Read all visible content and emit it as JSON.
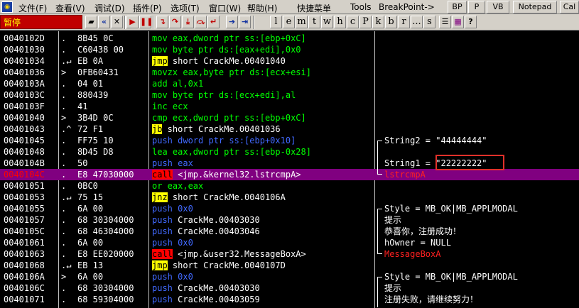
{
  "menu": {
    "items": [
      "文件(F)",
      "查看(V)",
      "调试(D)",
      "插件(P)",
      "选项(T)",
      "窗口(W)",
      "帮助(H)",
      "快捷菜单",
      "Tools",
      "BreakPoint->"
    ],
    "plugin_buttons": [
      "BP",
      "P",
      "VB",
      "Notepad",
      "Cal"
    ]
  },
  "toolbar": {
    "status": "暂停",
    "letters": [
      "l",
      "e",
      "m",
      "t",
      "w",
      "h",
      "c",
      "P",
      "k",
      "b",
      "r",
      "...",
      "s"
    ]
  },
  "rows": [
    {
      "addr": "0040102D",
      "mark": ".",
      "hex": "8B45 0C",
      "parts": [
        {
          "t": "mov",
          "s": "green"
        },
        {
          "t": " eax,dword ptr ss:[ebp+0xC]",
          "s": "green"
        }
      ]
    },
    {
      "addr": "00401030",
      "mark": ".",
      "hex": "C60438 00",
      "parts": [
        {
          "t": "mov",
          "s": "green"
        },
        {
          "t": " byte ptr ds:[eax+edi],0x0",
          "s": "green"
        }
      ]
    },
    {
      "addr": "00401034",
      "mark": ".↵",
      "hex": "EB 0A",
      "parts": [
        {
          "t": "jmp",
          "s": "jmp"
        },
        {
          "t": " short CrackMe.00401040",
          "s": ""
        }
      ]
    },
    {
      "addr": "00401036",
      "mark": ">",
      "hex": "0FB60431",
      "parts": [
        {
          "t": "movzx",
          "s": "green"
        },
        {
          "t": " eax,byte ptr ds:[ecx+esi]",
          "s": "green"
        }
      ]
    },
    {
      "addr": "0040103A",
      "mark": ".",
      "hex": "04 01",
      "parts": [
        {
          "t": "add",
          "s": "green"
        },
        {
          "t": " al,0x1",
          "s": "green"
        }
      ]
    },
    {
      "addr": "0040103C",
      "mark": ".",
      "hex": "880439",
      "parts": [
        {
          "t": "mov",
          "s": "green"
        },
        {
          "t": " byte ptr ds:[ecx+edi],al",
          "s": "green"
        }
      ]
    },
    {
      "addr": "0040103F",
      "mark": ".",
      "hex": "41",
      "parts": [
        {
          "t": "inc",
          "s": "green"
        },
        {
          "t": " ecx",
          "s": "green"
        }
      ]
    },
    {
      "addr": "00401040",
      "mark": ">",
      "hex": "3B4D 0C",
      "parts": [
        {
          "t": "cmp",
          "s": "green"
        },
        {
          "t": " ecx,dword ptr ss:[ebp+0xC]",
          "s": "green"
        }
      ]
    },
    {
      "addr": "00401043",
      "mark": ".^",
      "hex": "72 F1",
      "parts": [
        {
          "t": "jb",
          "s": "jmp"
        },
        {
          "t": " short CrackMe.00401036",
          "s": ""
        }
      ]
    },
    {
      "addr": "00401045",
      "mark": ".",
      "hex": "FF75 10",
      "parts": [
        {
          "t": "push",
          "s": "blue"
        },
        {
          "t": " dword ptr ss:[ebp+0x10]",
          "s": "blue"
        }
      ]
    },
    {
      "addr": "00401048",
      "mark": ".",
      "hex": "8D45 D8",
      "parts": [
        {
          "t": "lea",
          "s": "green"
        },
        {
          "t": " eax,dword ptr ss:[ebp-0x28]",
          "s": "green"
        }
      ]
    },
    {
      "addr": "0040104B",
      "mark": ".",
      "hex": "50",
      "parts": [
        {
          "t": "push",
          "s": "blue"
        },
        {
          "t": " eax",
          "s": "blue"
        }
      ]
    },
    {
      "addr": "0040104C",
      "mark": ".",
      "hex": "E8 47030000",
      "parts": [
        {
          "t": "call",
          "s": "call"
        },
        {
          "t": " <jmp.&kernel32.lstrcmpA>",
          "s": ""
        }
      ],
      "selected": true
    },
    {
      "addr": "00401051",
      "mark": ".",
      "hex": "0BC0",
      "parts": [
        {
          "t": "or",
          "s": "green"
        },
        {
          "t": " eax,eax",
          "s": "green"
        }
      ]
    },
    {
      "addr": "00401053",
      "mark": ".↵",
      "hex": "75 15",
      "parts": [
        {
          "t": "jnz",
          "s": "jmp"
        },
        {
          "t": " short CrackMe.0040106A",
          "s": ""
        }
      ]
    },
    {
      "addr": "00401055",
      "mark": ".",
      "hex": "6A 00",
      "parts": [
        {
          "t": "push",
          "s": "blue"
        },
        {
          "t": " 0x0",
          "s": "blue"
        }
      ]
    },
    {
      "addr": "00401057",
      "mark": ".",
      "hex": "68 30304000",
      "parts": [
        {
          "t": "push",
          "s": "blue"
        },
        {
          "t": " CrackMe.00403030",
          "s": ""
        }
      ]
    },
    {
      "addr": "0040105C",
      "mark": ".",
      "hex": "68 46304000",
      "parts": [
        {
          "t": "push",
          "s": "blue"
        },
        {
          "t": " CrackMe.00403046",
          "s": ""
        }
      ]
    },
    {
      "addr": "00401061",
      "mark": ".",
      "hex": "6A 00",
      "parts": [
        {
          "t": "push",
          "s": "blue"
        },
        {
          "t": " 0x0",
          "s": "blue"
        }
      ]
    },
    {
      "addr": "00401063",
      "mark": ".",
      "hex": "E8 EE020000",
      "parts": [
        {
          "t": "call",
          "s": "call"
        },
        {
          "t": " <jmp.&user32.MessageBoxA>",
          "s": ""
        }
      ]
    },
    {
      "addr": "00401068",
      "mark": ".↵",
      "hex": "EB 13",
      "parts": [
        {
          "t": "jmp",
          "s": "jmp"
        },
        {
          "t": " short CrackMe.0040107D",
          "s": ""
        }
      ]
    },
    {
      "addr": "0040106A",
      "mark": ">",
      "hex": "6A 00",
      "parts": [
        {
          "t": "push",
          "s": "blue"
        },
        {
          "t": " 0x0",
          "s": "blue"
        }
      ]
    },
    {
      "addr": "0040106C",
      "mark": ".",
      "hex": "68 30304000",
      "parts": [
        {
          "t": "push",
          "s": "blue"
        },
        {
          "t": " CrackMe.00403030",
          "s": ""
        }
      ]
    },
    {
      "addr": "00401071",
      "mark": ".",
      "hex": "68 59304000",
      "parts": [
        {
          "t": "push",
          "s": "blue"
        },
        {
          "t": " CrackMe.00403059",
          "s": ""
        }
      ]
    }
  ],
  "comments": [
    {
      "row": 9,
      "text": "String2 = \"44444444\"",
      "color": "white"
    },
    {
      "row": 11,
      "text": "String1 = \"22222222\"",
      "color": "white"
    },
    {
      "row": 12,
      "text": "lstrcmpA",
      "color": "red"
    },
    {
      "row": 15,
      "text": "Style = MB_OK|MB_APPLMODAL",
      "color": "white"
    },
    {
      "row": 16,
      "text": "提示",
      "color": "white"
    },
    {
      "row": 17,
      "text": "恭喜你，注册成功！",
      "color": "white"
    },
    {
      "row": 18,
      "text": "hOwner = NULL",
      "color": "white"
    },
    {
      "row": 19,
      "text": "MessageBoxA",
      "color": "red"
    },
    {
      "row": 21,
      "text": "Style = MB_OK|MB_APPLMODAL",
      "color": "white"
    },
    {
      "row": 22,
      "text": "提示",
      "color": "white"
    },
    {
      "row": 23,
      "text": "注册失败，请继续努力！",
      "color": "white"
    }
  ],
  "colors": {
    "selected_row": "#800080",
    "call": "#ff0000",
    "jump": "#ffff00",
    "highlight_box": "#e0302a"
  }
}
